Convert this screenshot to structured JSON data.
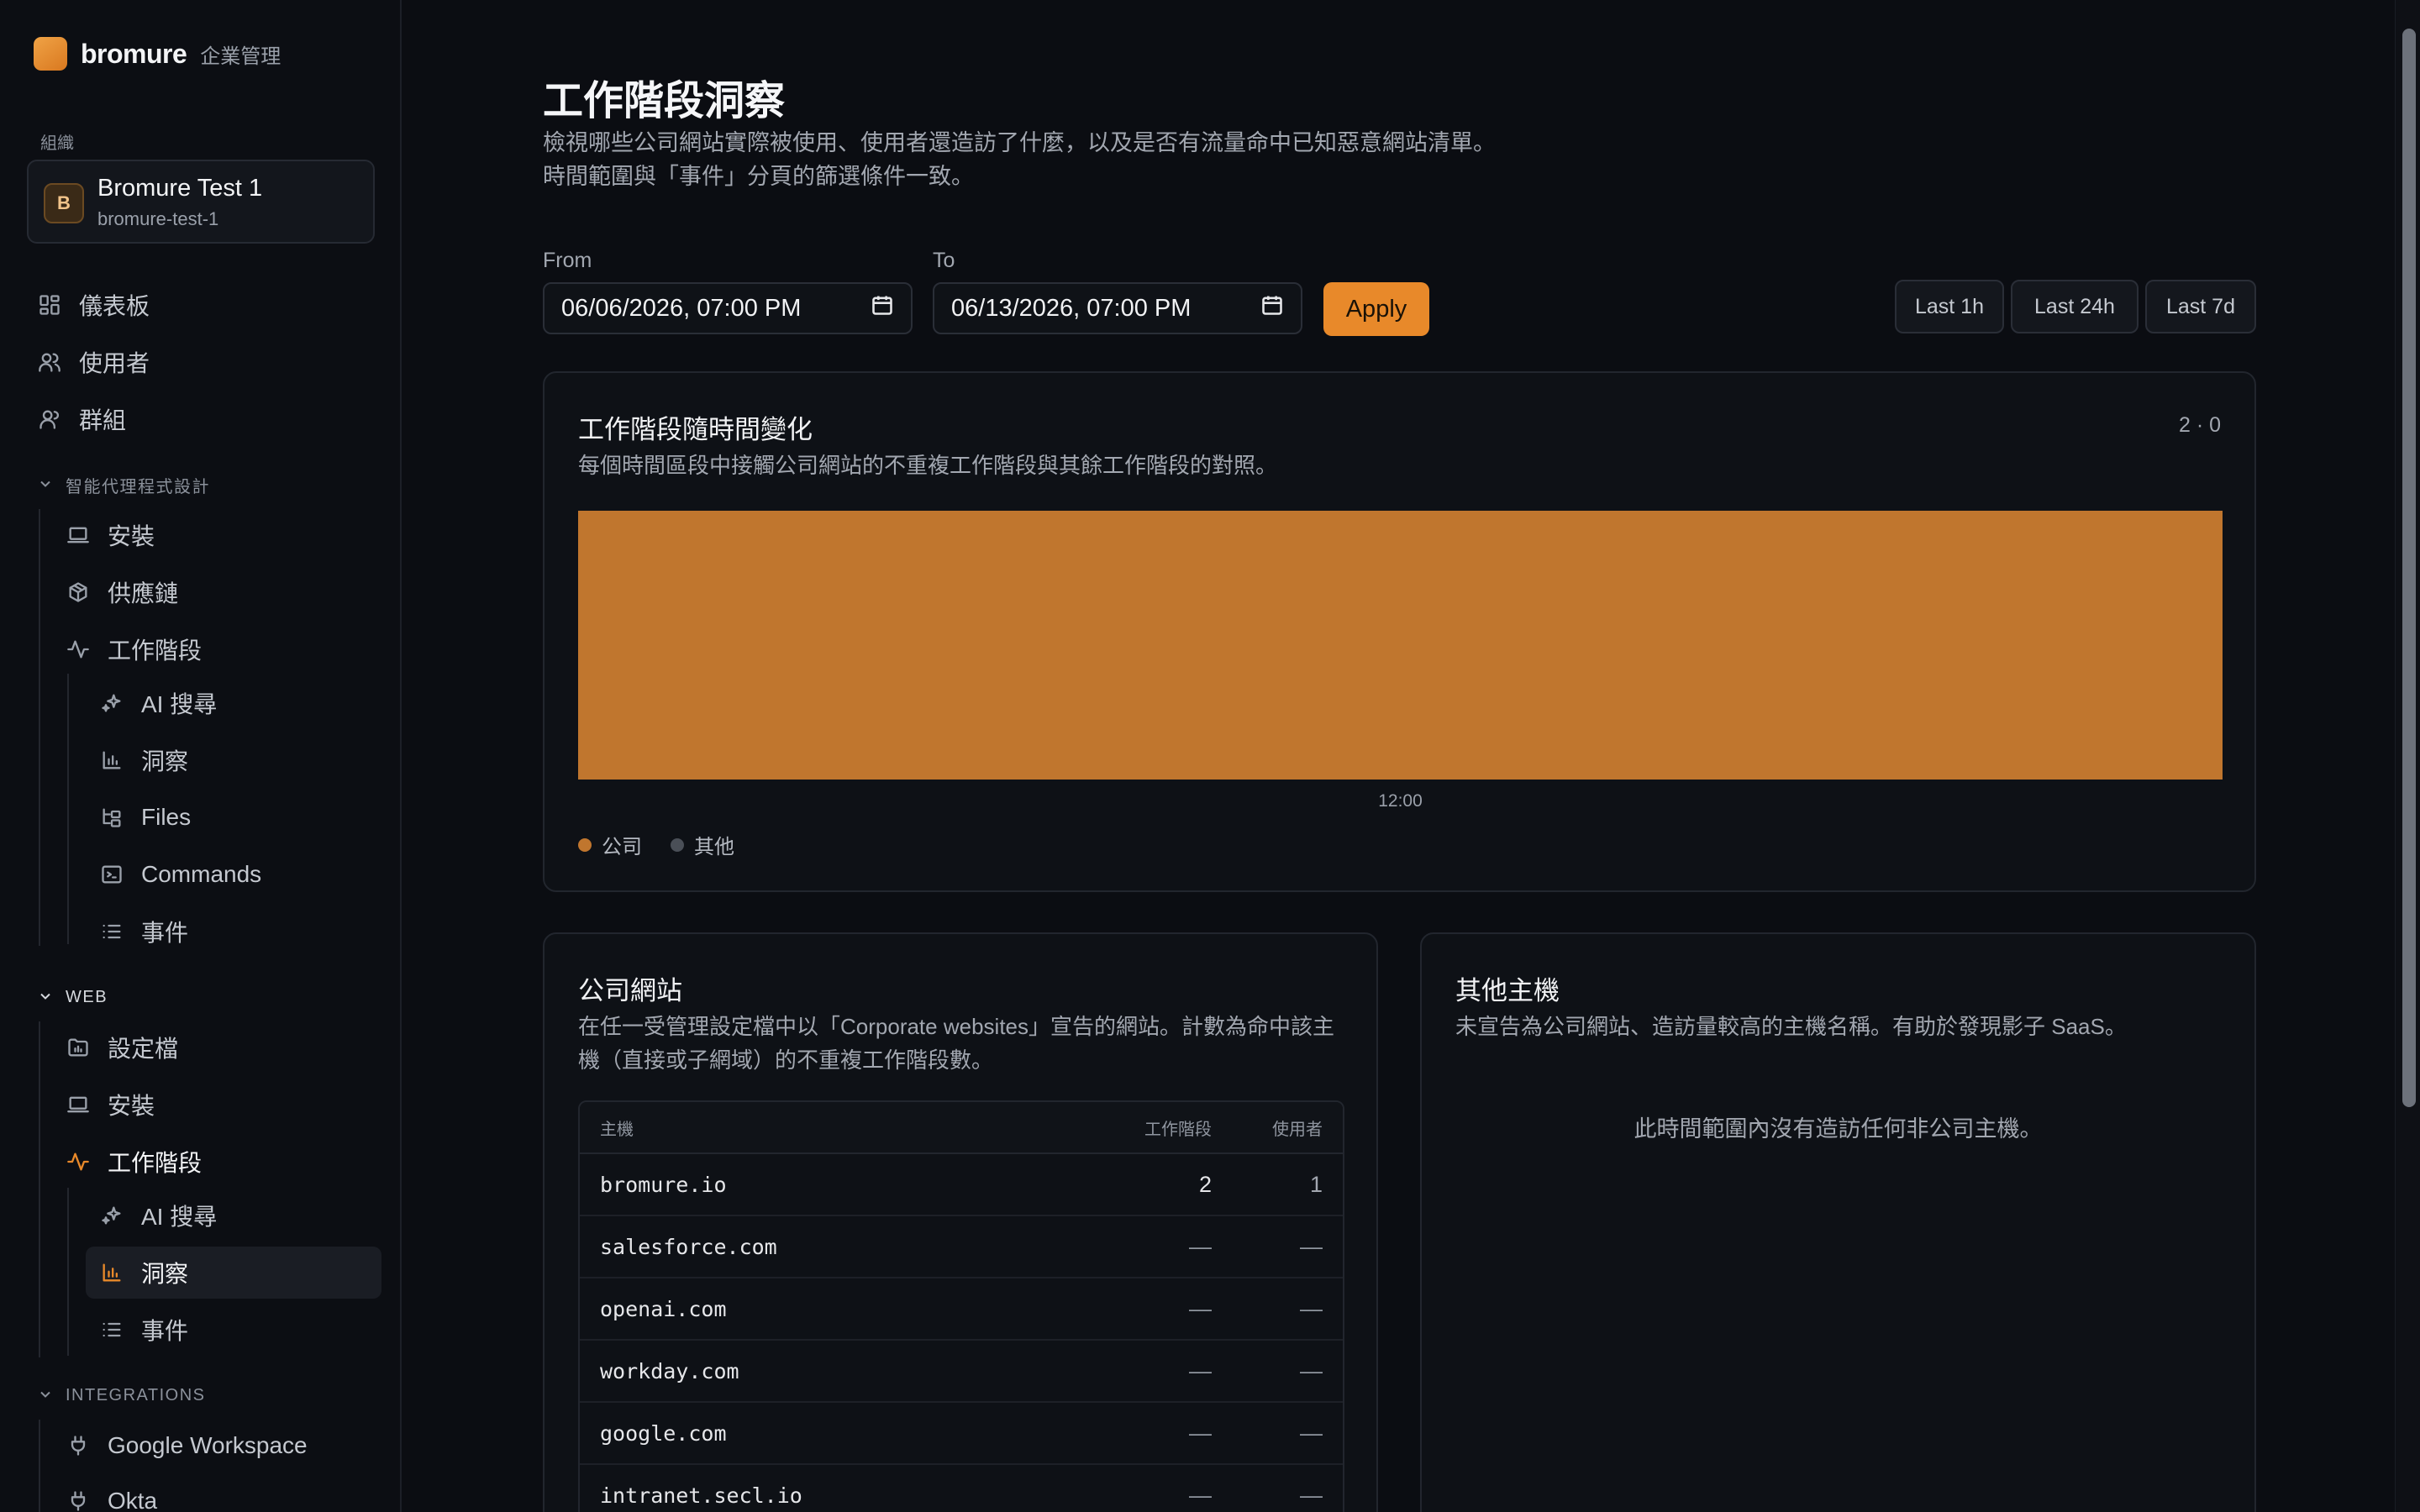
{
  "brand": {
    "name": "bromure",
    "subtitle": "企業管理"
  },
  "org": {
    "label": "組織",
    "avatar_letter": "B",
    "name": "Bromure Test 1",
    "slug": "bromure-test-1"
  },
  "nav": {
    "top": [
      {
        "label": "儀表板",
        "icon": "dashboard-icon"
      },
      {
        "label": "使用者",
        "icon": "user-icon"
      },
      {
        "label": "群組",
        "icon": "group-icon"
      }
    ],
    "agent_section": {
      "label": "智能代理程式設計",
      "items": [
        {
          "label": "安裝",
          "icon": "laptop-icon"
        },
        {
          "label": "供應鏈",
          "icon": "package-icon"
        },
        {
          "label": "工作階段",
          "icon": "activity-icon"
        }
      ],
      "sub_items": [
        {
          "label": "AI 搜尋",
          "icon": "sparkles-icon"
        },
        {
          "label": "洞察",
          "icon": "bar-chart-icon"
        },
        {
          "label": "Files",
          "icon": "folder-tree-icon"
        },
        {
          "label": "Commands",
          "icon": "terminal-icon"
        },
        {
          "label": "事件",
          "icon": "list-icon"
        }
      ]
    },
    "web_section": {
      "label": "WEB",
      "items": [
        {
          "label": "設定檔",
          "icon": "folder-chart-icon"
        },
        {
          "label": "安裝",
          "icon": "laptop-icon"
        },
        {
          "label": "工作階段",
          "icon": "activity-icon"
        }
      ],
      "sub_items": [
        {
          "label": "AI 搜尋",
          "icon": "sparkles-icon"
        },
        {
          "label": "洞察",
          "icon": "bar-chart-icon"
        },
        {
          "label": "事件",
          "icon": "list-icon"
        }
      ]
    },
    "integrations_section": {
      "label": "INTEGRATIONS",
      "items": [
        {
          "label": "Google Workspace",
          "icon": "plug-icon"
        },
        {
          "label": "Okta",
          "icon": "plug-icon"
        }
      ]
    }
  },
  "page": {
    "title": "工作階段洞察",
    "description": "檢視哪些公司網站實際被使用、使用者還造訪了什麼，以及是否有流量命中已知惡意網站清單。時間範圍與「事件」分頁的篩選條件一致。"
  },
  "filters": {
    "from_label": "From",
    "from_value": "06/06/2026, 07:00 PM",
    "to_label": "To",
    "to_value": "06/13/2026, 07:00 PM",
    "apply_label": "Apply",
    "ranges": [
      "Last 1h",
      "Last 24h",
      "Last 7d"
    ]
  },
  "timeline_card": {
    "title": "工作階段隨時間變化",
    "description": "每個時間區段中接觸公司網站的不重複工作階段與其餘工作階段的對照。",
    "summary": "2 · 0"
  },
  "chart_data": {
    "type": "bar",
    "stacked": true,
    "categories": [
      "12:00"
    ],
    "series": [
      {
        "name": "公司",
        "values": [
          2
        ],
        "color": "#c0762e"
      },
      {
        "name": "其他",
        "values": [
          0
        ],
        "color": "#4a4f57"
      }
    ],
    "ylim": [
      0,
      2
    ],
    "grid": false,
    "legend": "bottom-left"
  },
  "corporate_card": {
    "title": "公司網站",
    "description": "在任一受管理設定檔中以「Corporate websites」宣告的網站。計數為命中該主機（直接或子網域）的不重複工作階段數。",
    "columns": {
      "host": "主機",
      "sessions": "工作階段",
      "users": "使用者"
    },
    "rows": [
      {
        "host": "bromure.io",
        "sessions": "2",
        "users": "1"
      },
      {
        "host": "salesforce.com",
        "sessions": "—",
        "users": "—"
      },
      {
        "host": "openai.com",
        "sessions": "—",
        "users": "—"
      },
      {
        "host": "workday.com",
        "sessions": "—",
        "users": "—"
      },
      {
        "host": "google.com",
        "sessions": "—",
        "users": "—"
      },
      {
        "host": "intranet.secl.io",
        "sessions": "—",
        "users": "—"
      }
    ]
  },
  "other_card": {
    "title": "其他主機",
    "description": "未宣告為公司網站、造訪量較高的主機名稱。有助於發現影子 SaaS。",
    "empty": "此時間範圍內沒有造訪任何非公司主機。"
  },
  "colors": {
    "accent": "#e8892a",
    "bar_corporate": "#c0762e",
    "bar_other": "#4a4f57",
    "background": "#0b0d12"
  }
}
